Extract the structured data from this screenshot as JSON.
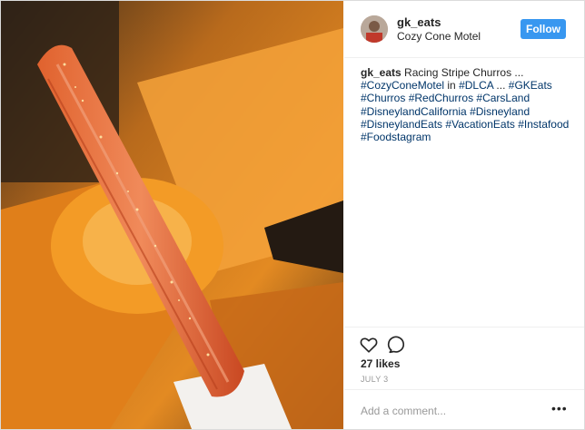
{
  "post": {
    "username": "gk_eats",
    "location": "Cozy Cone Motel",
    "follow_label": "Follow",
    "caption": {
      "text": "Racing Stripe Churros ...",
      "line2_a": "#CozyConeMotel",
      "line2_in": " in ",
      "line2_b": "#DLCA",
      "line2_dots": " ... ",
      "line2_c": "#GKEats",
      "line3_a": "#Churros",
      "line3_b": "#RedChurros",
      "line3_c": "#CarsLand",
      "line4_a": "#DisneylandCalifornia",
      "line4_b": "#Disneyland",
      "line5_a": "#DisneylandEats",
      "line5_b": "#VacationEats",
      "line5_c": "#Instafood",
      "line6_a": "#Foodstagram"
    },
    "likes": "27 likes",
    "date": "JULY 3",
    "comment_placeholder": "Add a comment...",
    "more_label": "•••"
  },
  "icons": {
    "like": "heart-icon",
    "comment": "comment-icon"
  },
  "colors": {
    "follow_button": "#3897f0",
    "hashtag": "#003569",
    "churro": "#d9542a",
    "cone": "#f08a1c"
  }
}
